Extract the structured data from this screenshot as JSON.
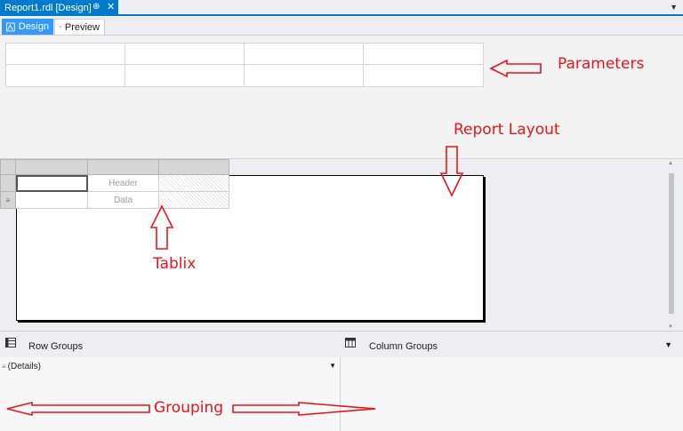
{
  "document_tab": {
    "title": "Report1.rdl [Design]",
    "pin_glyph": "⊕",
    "close_glyph": "✕"
  },
  "view_tabs": [
    {
      "label": "Design",
      "active": true
    },
    {
      "label": "Preview",
      "active": false
    }
  ],
  "tablix": {
    "header_text": "Header",
    "data_text": "Data"
  },
  "grouping": {
    "row_groups_label": "Row Groups",
    "column_groups_label": "Column Groups",
    "details_label": "(Details)"
  },
  "annotations": {
    "parameters": "Parameters",
    "report_layout": "Report Layout",
    "tablix": "Tablix",
    "grouping": "Grouping"
  },
  "colors": {
    "accent": "#007acc",
    "active_tab": "#3399ff",
    "annotation": "#e8151b"
  }
}
